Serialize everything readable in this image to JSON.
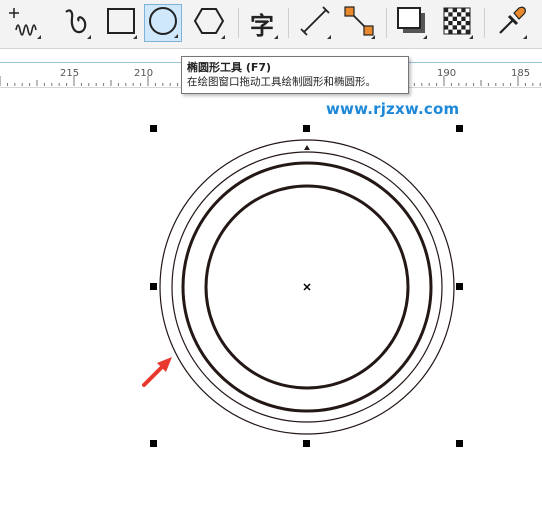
{
  "toolbar": {
    "tools": [
      {
        "name": "freehand-tool",
        "icon": "freehand-icon"
      },
      {
        "name": "artistic-media-tool",
        "icon": "spiral-icon"
      },
      {
        "name": "rectangle-tool",
        "icon": "rectangle-icon"
      },
      {
        "name": "ellipse-tool",
        "icon": "ellipse-icon",
        "active": true
      },
      {
        "name": "polygon-tool",
        "icon": "hexagon-icon"
      },
      {
        "name": "text-tool",
        "icon": "text-icon",
        "glyph": "字"
      },
      {
        "name": "dimension-tool",
        "icon": "dimension-line-icon"
      },
      {
        "name": "connector-tool",
        "icon": "connector-icon"
      },
      {
        "name": "drop-shadow-tool",
        "icon": "drop-shadow-icon"
      },
      {
        "name": "transparency-tool",
        "icon": "checkerboard-icon"
      },
      {
        "name": "eyedropper-tool",
        "icon": "eyedropper-icon"
      }
    ]
  },
  "ruler": {
    "labels": [
      "215",
      "210",
      "190",
      "185"
    ]
  },
  "tooltip": {
    "title": "椭圆形工具 (F7)",
    "description": "在绘图窗口拖动工具绘制圆形和椭圆形。"
  },
  "watermark": {
    "text": "www.rjzxw.com"
  },
  "colors": {
    "active_tool_bg": "#cfe8fb",
    "ruler_accent": "#9bc4dd",
    "circle_stroke": "#231815",
    "arrow": "#e8392f",
    "watermark": "#1e88d8"
  }
}
